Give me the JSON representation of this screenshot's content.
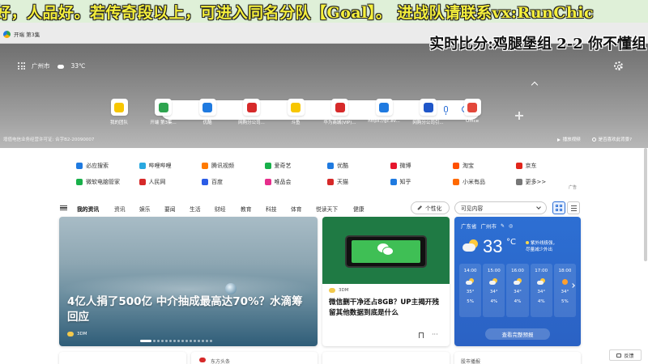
{
  "overlay": {
    "top_banner": "好，人品好。若传奇段以上，可进入同名分队【Goal】。 进战队请联系vx:RunChic",
    "score": "实时比分:鸡腿堡组 2-2 你不懂组"
  },
  "browser": {
    "tab_title": "开端 第3集"
  },
  "header": {
    "city": "广州市",
    "temp": "33℃",
    "footer_notice": "增值电信业务经营许可证: 合字B2-20090007",
    "play_video": "播放视频",
    "like_bg": "是否喜欢此背景?"
  },
  "search": {
    "placeholder": ""
  },
  "shortcuts": [
    {
      "label": "我的团队",
      "color": "#f7c600",
      "icon": "team-icon"
    },
    {
      "label": "开端 第3集...",
      "color": "#2ea44f",
      "icon": "play-icon"
    },
    {
      "label": "优酷",
      "color": "#1f7ae0",
      "icon": "youku-icon"
    },
    {
      "label": "网购分公司...",
      "color": "#d62929",
      "icon": "huawei-icon"
    },
    {
      "label": "斗鱼",
      "color": "#f7c600",
      "icon": "douyu-icon"
    },
    {
      "label": "华为商城(VIP)...",
      "color": "#d62929",
      "icon": "huawei-icon"
    },
    {
      "label": "https://gc.ev...",
      "color": "#1f7ae0",
      "icon": "edge-icon"
    },
    {
      "label": "网购分公司引...",
      "color": "#1f56c9",
      "icon": "ip-icon"
    },
    {
      "label": "Office",
      "color": "#e3473a",
      "icon": "office-icon"
    }
  ],
  "links": {
    "row1": [
      {
        "label": "必应搜索",
        "color": "#1f7ae0"
      },
      {
        "label": "哔哩哔哩",
        "color": "#29a8e0"
      },
      {
        "label": "腾讯视频",
        "color": "#ff7a00"
      },
      {
        "label": "爱奇艺",
        "color": "#18b04a"
      },
      {
        "label": "优酷",
        "color": "#1f7ae0"
      },
      {
        "label": "微博",
        "color": "#e6162d"
      },
      {
        "label": "淘宝",
        "color": "#ff5000"
      },
      {
        "label": "京东",
        "color": "#e1251b"
      }
    ],
    "row2": [
      {
        "label": "微软电脑管家",
        "color": "#18b04a"
      },
      {
        "label": "人民网",
        "color": "#d62929"
      },
      {
        "label": "百度",
        "color": "#2b5ce6"
      },
      {
        "label": "唯品会",
        "color": "#e62e8c"
      },
      {
        "label": "天猫",
        "color": "#d62929"
      },
      {
        "label": "知乎",
        "color": "#1f7ae0"
      },
      {
        "label": "小米有品",
        "color": "#ff6900"
      },
      {
        "label": "更多>>",
        "color": "#777777"
      }
    ],
    "ad_label": "广告"
  },
  "nav": {
    "items": [
      "我的资讯",
      "资讯",
      "娱乐",
      "要闻",
      "生活",
      "财经",
      "教育",
      "科技",
      "体育",
      "悦读天下",
      "健康"
    ],
    "personalize": "个性化",
    "visible_content": "可见内容"
  },
  "cards": {
    "main": {
      "title": "4亿人捐了500亿 中介抽成最高达70%？水滴筹回应",
      "source": "3DM"
    },
    "secondary": {
      "source": "3DM",
      "title": "微信删干净还占8GB？UP主揭开残留其他数据到底是什么"
    },
    "peek": [
      "",
      "东方头条",
      "",
      "",
      "股市播报"
    ]
  },
  "weather": {
    "province": "广东省",
    "city": "广州市",
    "temp": "33",
    "unit": "°C",
    "alert_line1": "紫外线极强，",
    "alert_line2": "尽量减少外出",
    "hours": [
      {
        "time": "14:00",
        "temp": "35°",
        "rain": "5%",
        "icon": "partly-cloudy-icon"
      },
      {
        "time": "15:00",
        "temp": "34°",
        "rain": "4%",
        "icon": "partly-cloudy-icon"
      },
      {
        "time": "16:00",
        "temp": "34°",
        "rain": "4%",
        "icon": "partly-cloudy-icon"
      },
      {
        "time": "17:00",
        "temp": "34°",
        "rain": "4%",
        "icon": "partly-cloudy-icon"
      },
      {
        "time": "18:00",
        "temp": "34°",
        "rain": "5%",
        "icon": "sunny-icon"
      }
    ],
    "forecast_button": "查看完整预报"
  },
  "feedback": "反馈"
}
